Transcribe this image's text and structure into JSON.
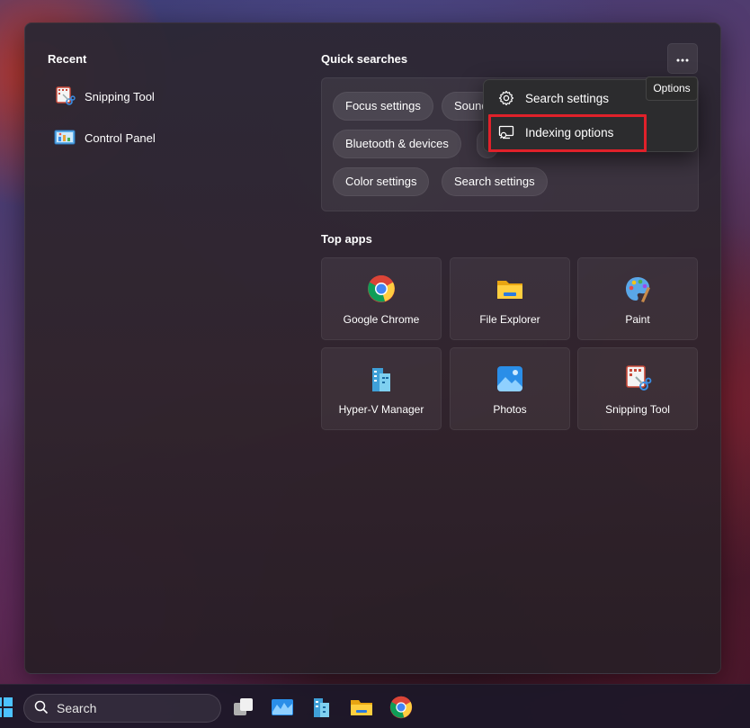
{
  "recent": {
    "title": "Recent",
    "items": [
      {
        "label": "Snipping Tool",
        "icon": "snipping-tool-icon"
      },
      {
        "label": "Control Panel",
        "icon": "control-panel-icon"
      }
    ]
  },
  "quick_searches": {
    "title": "Quick searches",
    "chips": [
      "Focus settings",
      "Sound",
      "Bluetooth & devices",
      "Color settings",
      "Search settings"
    ]
  },
  "options": {
    "tooltip": "Options",
    "menu": [
      {
        "label": "Search settings",
        "icon": "gear-icon"
      },
      {
        "label": "Indexing options",
        "icon": "indexing-icon"
      }
    ],
    "highlight_color": "#e0212a"
  },
  "top_apps": {
    "title": "Top apps",
    "apps": [
      {
        "label": "Google Chrome",
        "icon": "chrome-icon"
      },
      {
        "label": "File Explorer",
        "icon": "file-explorer-icon"
      },
      {
        "label": "Paint",
        "icon": "paint-icon"
      },
      {
        "label": "Hyper-V Manager",
        "icon": "hyper-v-icon"
      },
      {
        "label": "Photos",
        "icon": "photos-icon"
      },
      {
        "label": "Snipping Tool",
        "icon": "snipping-tool-icon"
      }
    ]
  },
  "taskbar": {
    "search_placeholder": "Search",
    "icons": [
      "start-icon",
      "search-icon",
      "task-view-icon",
      "resource-monitor-icon",
      "hyper-v-icon",
      "file-explorer-icon",
      "chrome-icon"
    ]
  }
}
